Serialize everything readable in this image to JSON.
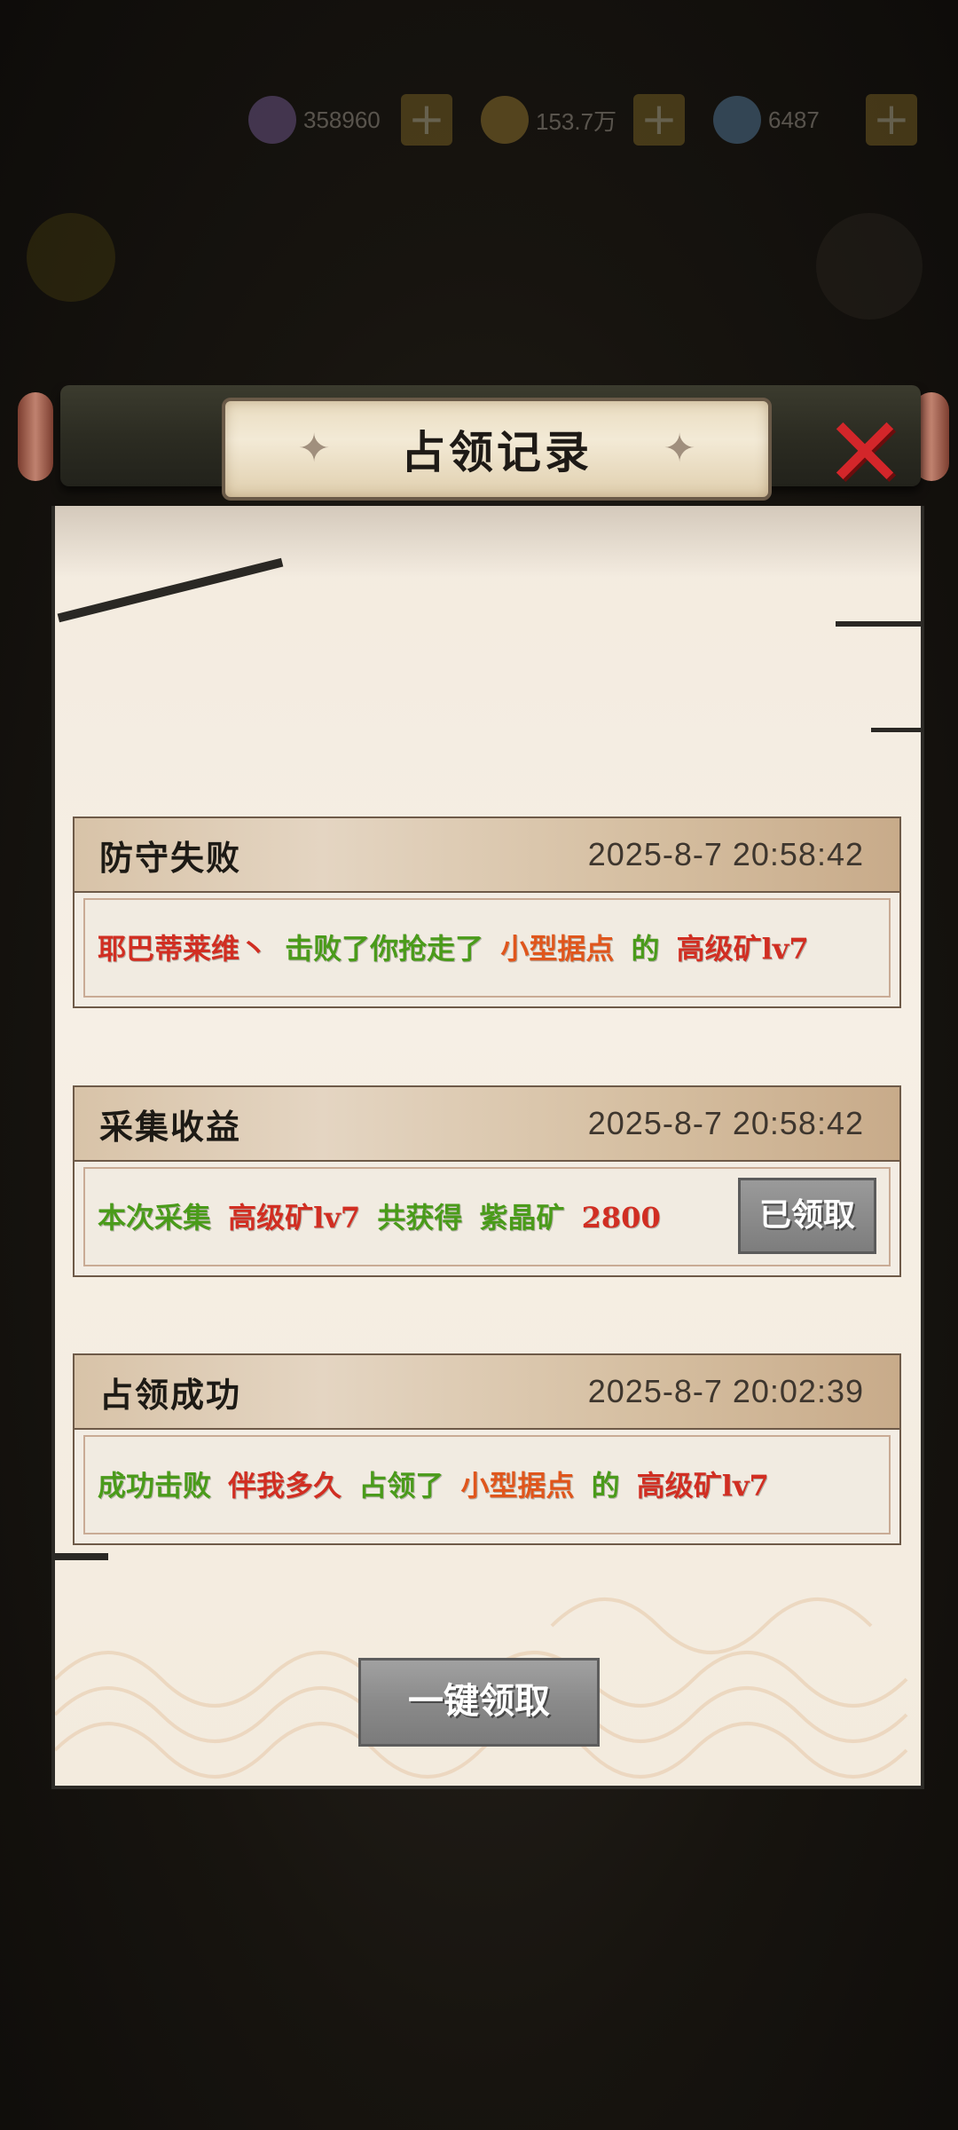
{
  "topbar": {
    "resources": [
      {
        "icon": "purple-crystal-icon",
        "value": "358960",
        "color": "#9a78c8"
      },
      {
        "icon": "gold-coin-icon",
        "value": "153.7万",
        "color": "#c9a13e"
      },
      {
        "icon": "rainbow-gem-icon",
        "value": "6487",
        "color": "#6fa7d8"
      }
    ],
    "plus_label": "+"
  },
  "panel": {
    "title": "占领记录",
    "close_label": "✕",
    "records": [
      {
        "type": "防守失败",
        "time": "2025-8-7  20:58:42",
        "message": [
          {
            "text": "耶巴蒂莱维丶",
            "color": "red"
          },
          {
            "text": "击败了你抢走了",
            "color": "green"
          },
          {
            "text": "小型据点",
            "color": "orange"
          },
          {
            "text": "的",
            "color": "green"
          },
          {
            "text": "高级矿lv7",
            "color": "red"
          }
        ]
      },
      {
        "type": "采集收益",
        "time": "2025-8-7  20:58:42",
        "message": [
          {
            "text": "本次采集",
            "color": "green"
          },
          {
            "text": "高级矿lv7",
            "color": "red"
          },
          {
            "text": "共获得",
            "color": "green"
          },
          {
            "text": "紫晶矿",
            "color": "green"
          },
          {
            "text": "2800",
            "color": "red"
          }
        ],
        "button": "已领取"
      },
      {
        "type": "占领成功",
        "time": "2025-8-7  20:02:39",
        "message": [
          {
            "text": "成功击败",
            "color": "green"
          },
          {
            "text": "伴我多久",
            "color": "red"
          },
          {
            "text": "占领了",
            "color": "green"
          },
          {
            "text": "小型据点",
            "color": "orange"
          },
          {
            "text": "的",
            "color": "green"
          },
          {
            "text": "高级矿lv7",
            "color": "red"
          }
        ]
      }
    ],
    "claim_all_label": "一键领取"
  }
}
